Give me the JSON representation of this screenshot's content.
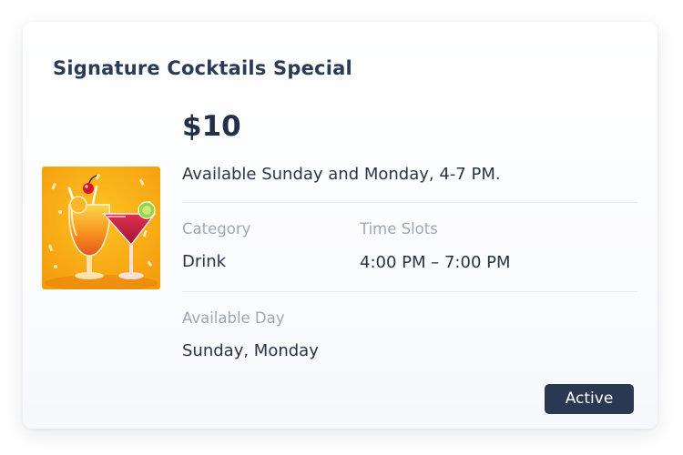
{
  "card": {
    "title": "Signature Cocktails Special",
    "price": "$10",
    "description": "Available Sunday and Monday, 4-7 PM.",
    "image_icon": "cocktails-image",
    "fields": {
      "category_label": "Category",
      "category_value": "Drink",
      "time_slots_label": "Time Slots",
      "time_slots_value": "4:00 PM – 7:00 PM",
      "available_day_label": "Available Day",
      "available_day_value": "Sunday, Monday"
    },
    "status": "Active"
  },
  "colors": {
    "title": "#2b3a55",
    "badge_bg": "#2b3852",
    "label": "#a0a7b4",
    "image_bg": "#f9a911"
  }
}
